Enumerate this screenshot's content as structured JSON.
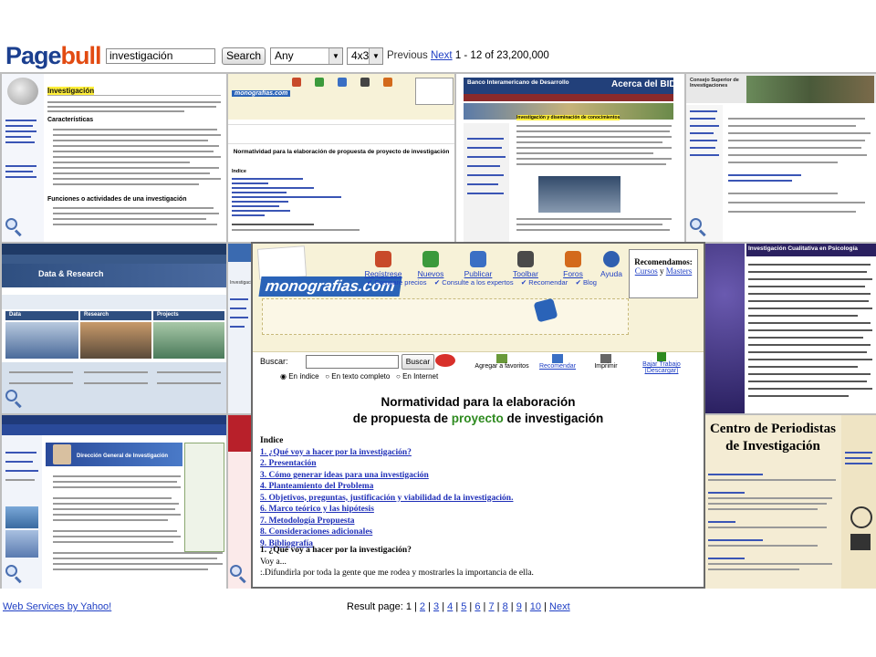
{
  "app": {
    "logo_part1": "Page",
    "logo_part2": "bull"
  },
  "search": {
    "query": "investigación",
    "button": "Search"
  },
  "filters": {
    "type_value": "Any",
    "layout_value": "4x3"
  },
  "pager_top": {
    "previous": "Previous",
    "next": "Next",
    "summary": "1 - 12 of 23,200,000"
  },
  "results": [
    {
      "title": "Investigación",
      "subtitle": "Características",
      "section": "Funciones o actividades de una investigación"
    },
    {
      "header": "monografias.com",
      "title": "Normatividad para la elaboración de propuesta de proyecto de investigación",
      "toc_label": "Indice"
    },
    {
      "header": "Banco Interamericano de Desarrollo",
      "title": "Acerca del BID",
      "section": "Investigación y diseminación de conocimientos"
    },
    {
      "header": "Consejo Superior de Investigaciones"
    },
    {
      "header": "Data & Research",
      "columns": [
        "Data",
        "Research",
        "Projects"
      ]
    },
    {
      "header": "Investigación"
    },
    {
      "header": "Investigación Cualitativa en Psicología"
    },
    {
      "header": "Dirección General de Investigación"
    },
    {
      "header": "Centro de Periodistas de Investigación"
    }
  ],
  "overlay": {
    "logo": "monografias.com",
    "nav": [
      {
        "label": "Regístrese",
        "color": "#c84a2a"
      },
      {
        "label": "Nuevos",
        "color": "#3c9a3c"
      },
      {
        "label": "Publicar",
        "color": "#3a6fc4"
      },
      {
        "label": "Toolbar",
        "color": "#4a4a4a"
      },
      {
        "label": "Foros",
        "color": "#d36a1c"
      },
      {
        "label": "Ayuda",
        "color": "#2f5fb0"
      }
    ],
    "subnav": [
      "Compare precios",
      "Consulte a los expertos",
      "Recomendar",
      "Blog"
    ],
    "recommend": {
      "title": "Recomendamos:",
      "link1": "Cursos",
      "connector": "y",
      "link2": "Masters"
    },
    "search_label": "Buscar:",
    "search_button": "Buscar",
    "radios": [
      "En índice",
      "En texto completo",
      "En Internet"
    ],
    "actions": [
      "Agregar a favoritos",
      "Recomendar",
      "Imprimir",
      "Bajar Trabajo (Descargar)"
    ],
    "title_line1": "Normatividad para la elaboración",
    "title_line2_pre": "de propuesta de ",
    "title_line2_green": "proyecto",
    "title_line2_post": " de investigación",
    "index_label": "Indice",
    "toc": [
      "1. ¿Qué voy a hacer por la investigación?",
      "2. Presentación",
      "3. Cómo generar ideas para una investigación",
      "4. Planteamiento del Problema",
      "5. Objetivos, preguntas, justificación y viabilidad de la investigación.",
      "6. Marco teórico y las hipótesis",
      "7. Metodología Propuesta",
      "8. Consideraciones adicionales",
      "9. Bibliografía"
    ],
    "body_heading": "1. ¿Qué voy a hacer por la investigación?",
    "body_line1": "Voy a...",
    "body_line2": ":.Difundirla por toda la gente que me rodea y mostrarles la importancia de ella."
  },
  "footer": {
    "yahoo": "Web Services by Yahoo!",
    "result_label": "Result page: 1",
    "pages": [
      "2",
      "3",
      "4",
      "5",
      "6",
      "7",
      "8",
      "9",
      "10"
    ],
    "next": "Next"
  }
}
